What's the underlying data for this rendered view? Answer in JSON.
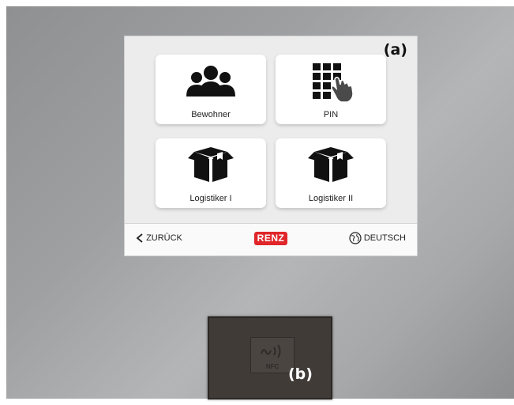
{
  "screen": {
    "label": "(a)",
    "tiles": [
      {
        "label": "Bewohner",
        "icon": "users-icon"
      },
      {
        "label": "PIN",
        "icon": "keypad-tap-icon"
      },
      {
        "label": "Logistiker I",
        "icon": "package-icon"
      },
      {
        "label": "Logistiker II",
        "icon": "package-icon"
      }
    ],
    "bottom_bar": {
      "back_label": "ZURÜCK",
      "logo_text": "RENZ",
      "language_label": "DEUTSCH"
    }
  },
  "reader": {
    "label": "(b)",
    "nfc_text": "NFC"
  },
  "colors": {
    "panel": "#a0a1a3",
    "screen": "#ececec",
    "logo": "#e0262a",
    "reader": "#403b37"
  }
}
